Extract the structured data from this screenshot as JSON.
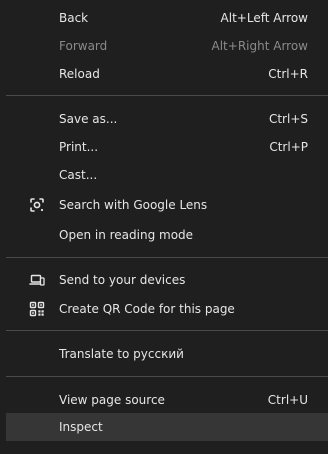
{
  "menu": {
    "back": {
      "label": "Back",
      "shortcut": "Alt+Left Arrow"
    },
    "forward": {
      "label": "Forward",
      "shortcut": "Alt+Right Arrow",
      "disabled": true
    },
    "reload": {
      "label": "Reload",
      "shortcut": "Ctrl+R"
    },
    "save_as": {
      "label": "Save as...",
      "shortcut": "Ctrl+S"
    },
    "print": {
      "label": "Print...",
      "shortcut": "Ctrl+P"
    },
    "cast": {
      "label": "Cast..."
    },
    "search_lens": {
      "label": "Search with Google Lens",
      "icon": "google-lens-icon"
    },
    "reading_mode": {
      "label": "Open in reading mode"
    },
    "send_devices": {
      "label": "Send to your devices",
      "icon": "devices-icon"
    },
    "qr_code": {
      "label": "Create QR Code for this page",
      "icon": "qr-code-icon"
    },
    "translate": {
      "label": "Translate to русский"
    },
    "view_source": {
      "label": "View page source",
      "shortcut": "Ctrl+U"
    },
    "inspect": {
      "label": "Inspect",
      "highlighted": true
    }
  },
  "colors": {
    "background": "#1f1f1f",
    "text": "#e6e6e6",
    "disabled_text": "#8a8a8a",
    "separator": "#4a4a4a",
    "highlight": "#363636"
  }
}
